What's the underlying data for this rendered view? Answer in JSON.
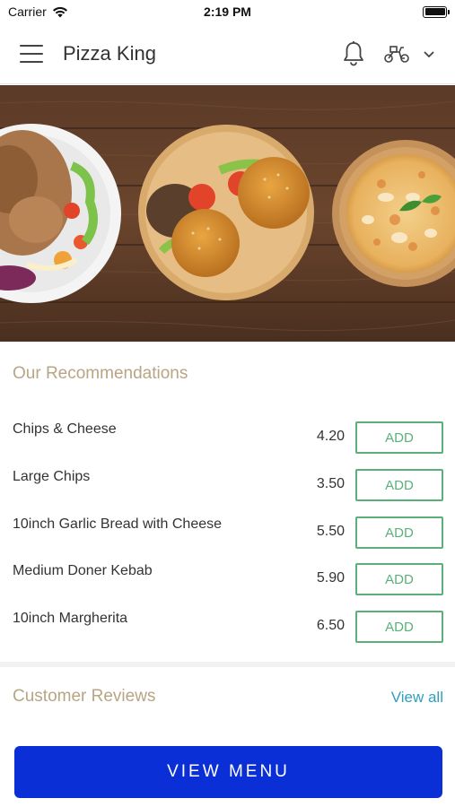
{
  "status_bar": {
    "carrier": "Carrier",
    "time": "2:19 PM"
  },
  "header": {
    "title": "Pizza King",
    "menu_icon": "hamburger-icon",
    "notification_icon": "bell-icon",
    "delivery_icon": "scooter-icon",
    "dropdown_icon": "chevron-down-icon"
  },
  "hero": {
    "image": "food-banner",
    "items": [
      "doner-kebab-plate",
      "burgers-board",
      "pizza-board"
    ]
  },
  "recommendations": {
    "title": "Our Recommendations",
    "items": [
      {
        "name": "Chips & Cheese",
        "price": "4.20",
        "action": "ADD"
      },
      {
        "name": "Large Chips",
        "price": "3.50",
        "action": "ADD"
      },
      {
        "name": "10inch Garlic Bread with Cheese",
        "price": "5.50",
        "action": "ADD"
      },
      {
        "name": "Medium Doner Kebab",
        "price": "5.90",
        "action": "ADD"
      },
      {
        "name": "10inch Margherita",
        "price": "6.50",
        "action": "ADD"
      }
    ]
  },
  "reviews": {
    "title": "Customer Reviews",
    "view_all": "View all"
  },
  "footer": {
    "view_menu": "VIEW MENU"
  },
  "colors": {
    "accent_gold": "#b8a583",
    "add_green": "#5bb07a",
    "link_blue": "#2f9fbd",
    "primary_button": "#0a2fd6"
  }
}
